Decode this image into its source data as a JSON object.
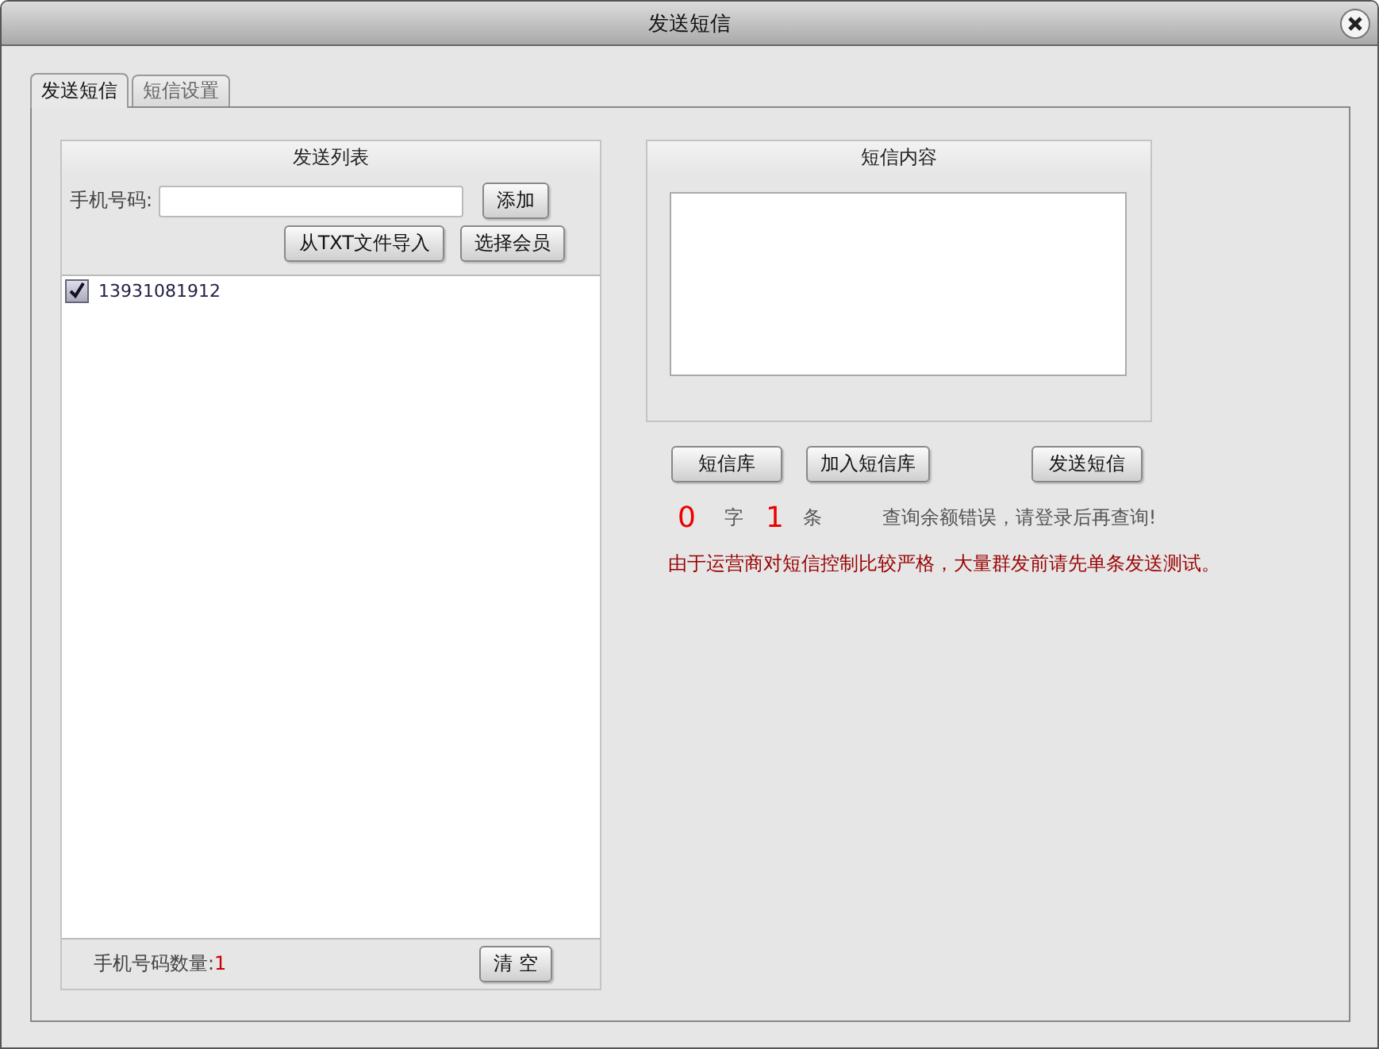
{
  "window": {
    "title": "发送短信"
  },
  "tabs": [
    {
      "label": "发送短信",
      "selected": true
    },
    {
      "label": "短信设置",
      "selected": false
    }
  ],
  "send_list": {
    "title": "发送列表",
    "phone_label": "手机号码:",
    "add_button": "添加",
    "import_button": "从TXT文件导入",
    "member_button": "选择会员",
    "items": [
      {
        "number": "13931081912",
        "checked": true
      }
    ],
    "count_label": "手机号码数量:",
    "count_value": "1",
    "clear_button": "清 空"
  },
  "content": {
    "title": "短信内容"
  },
  "buttons": [
    "短信库",
    "加入短信库",
    "发送短信"
  ],
  "counter": {
    "chars": "0",
    "chars_unit": "字",
    "messages": "1",
    "messages_unit": "条"
  },
  "balance_message": "查询余额错误，请登录后再查询!",
  "warning": "由于运营商对短信控制比较严格，大量群发前请先单条发送测试。"
}
